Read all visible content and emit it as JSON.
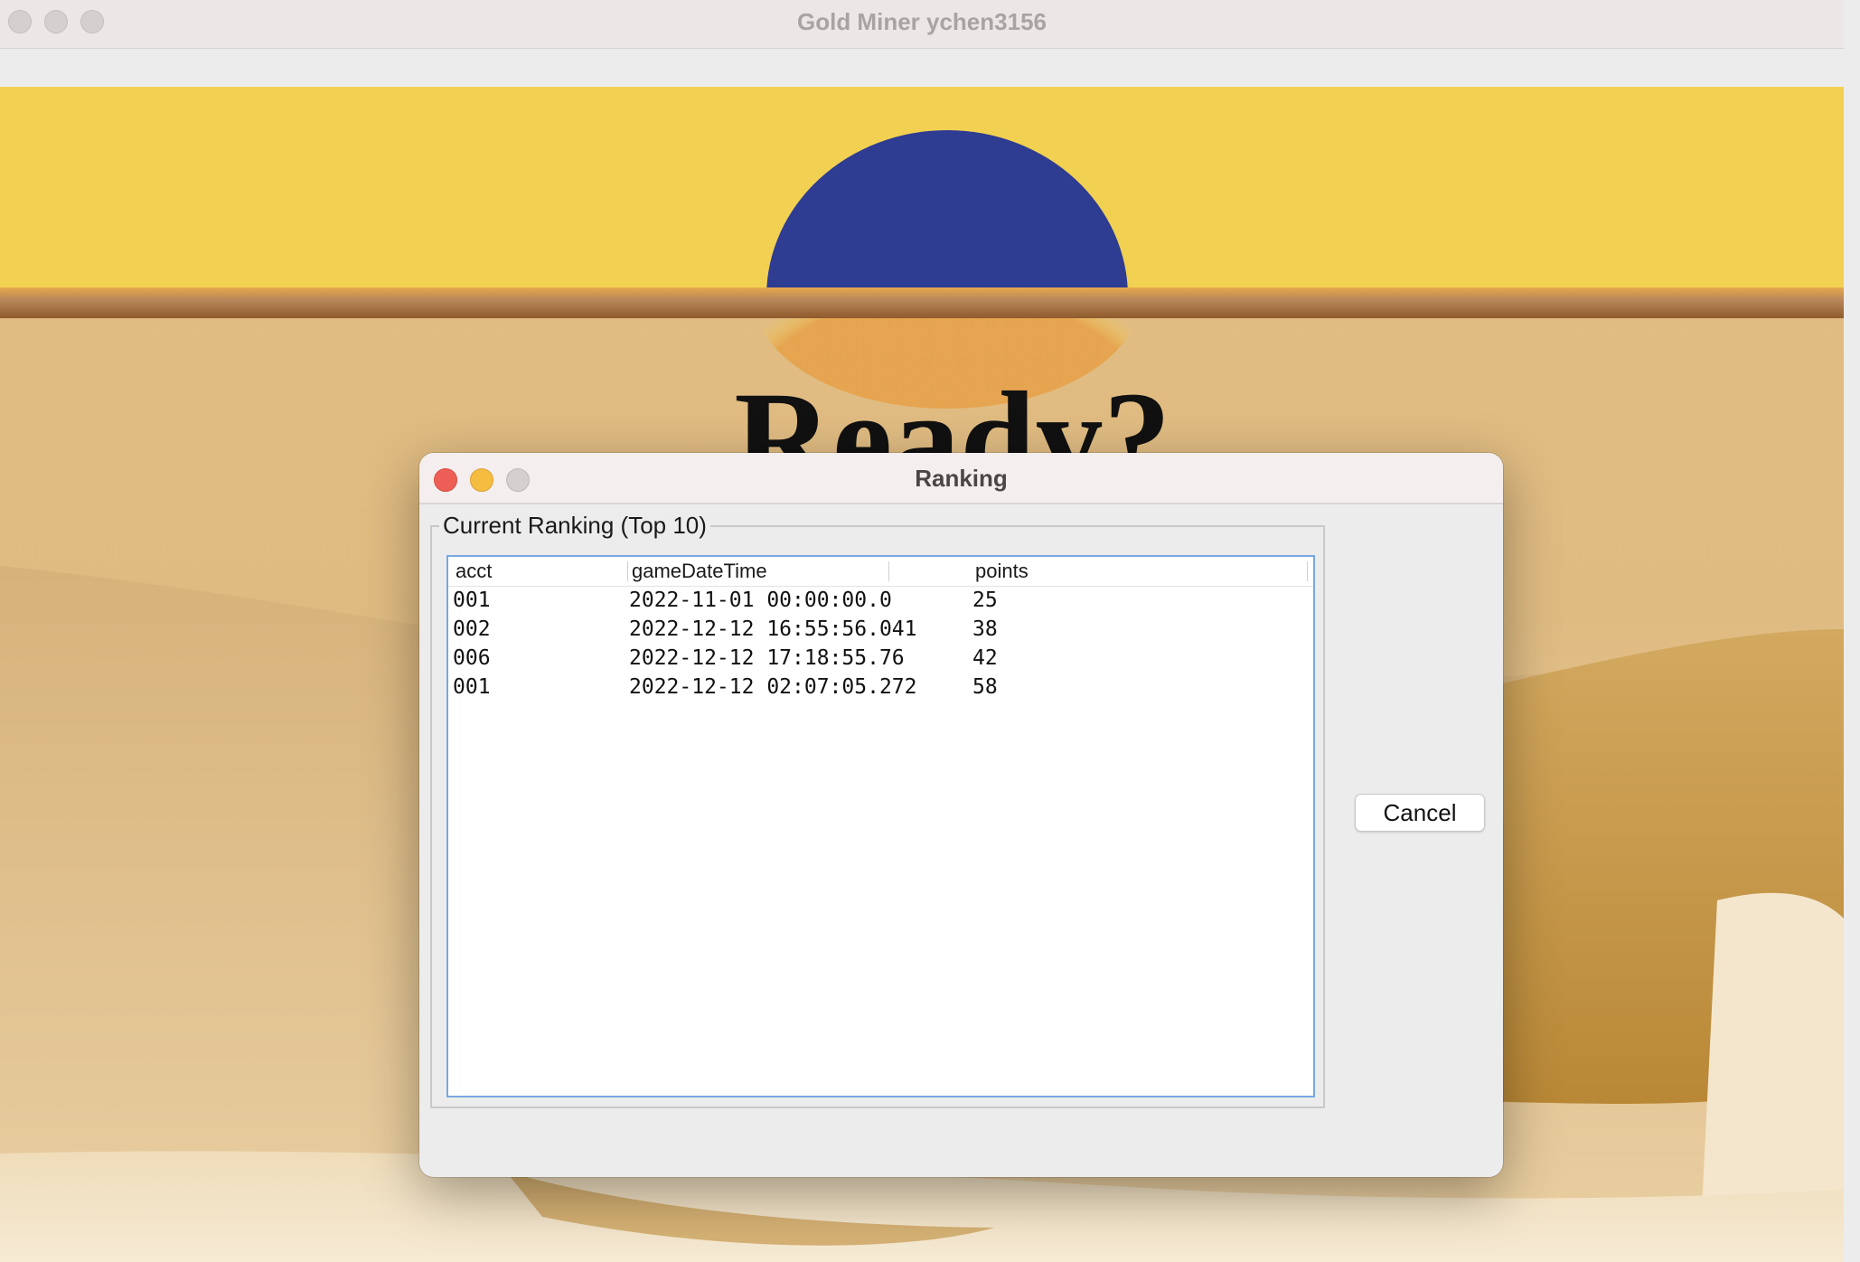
{
  "window": {
    "title": "Gold Miner ychen3156"
  },
  "game": {
    "ready_text": "Ready?",
    "colors": {
      "sky": "#f2d152",
      "sun": "#2e3c92",
      "sand": "#e2bd83",
      "ground_band": "#b8875a"
    }
  },
  "dialog": {
    "title": "Ranking",
    "group_title": "Current Ranking (Top 10)",
    "cancel_label": "Cancel",
    "table": {
      "columns": [
        "acct",
        "gameDateTime",
        "points"
      ],
      "rows": [
        [
          "001",
          "2022-11-01 00:00:00.0",
          "25"
        ],
        [
          "002",
          "2022-12-12 16:55:56.041",
          "38"
        ],
        [
          "006",
          "2022-12-12 17:18:55.76",
          "42"
        ],
        [
          "001",
          "2022-12-12 02:07:05.272",
          "58"
        ]
      ]
    }
  }
}
